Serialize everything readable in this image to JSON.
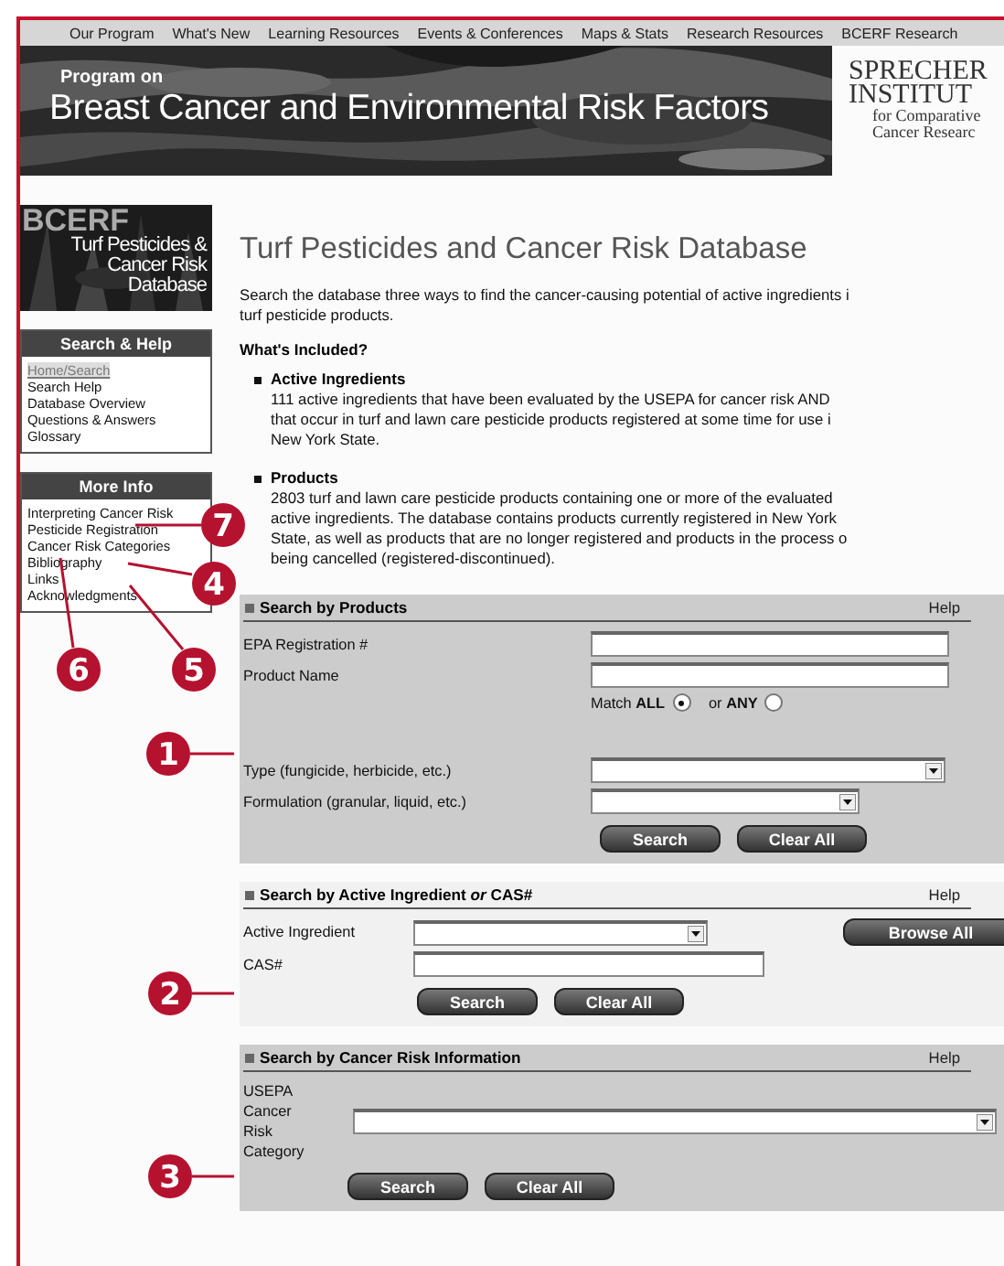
{
  "nav": [
    "Our Program",
    "What's New",
    "Learning Resources",
    "Events & Conferences",
    "Maps & Stats",
    "Research Resources",
    "BCERF Research"
  ],
  "banner": {
    "kicker": "Program on",
    "title": "Breast Cancer and Environmental Risk Factors"
  },
  "logo": {
    "lines": [
      "SPRECHER",
      "INSTITUT",
      "for Comparative",
      "Cancer Researc"
    ]
  },
  "sidebar": {
    "badge": {
      "lines": [
        "BCERF",
        "Turf Pesticides &",
        "Cancer Risk",
        "Database"
      ]
    },
    "boxes": [
      {
        "title": "Search & Help",
        "items": [
          {
            "label": "Home/Search",
            "selected": true
          },
          {
            "label": "Search Help",
            "selected": false
          },
          {
            "label": "Database Overview",
            "selected": false
          },
          {
            "label": "Questions & Answers",
            "selected": false
          },
          {
            "label": "Glossary",
            "selected": false
          }
        ]
      },
      {
        "title": "More Info",
        "items": [
          {
            "label": "Interpreting Cancer Risk",
            "selected": false
          },
          {
            "label": "Pesticide Registration",
            "selected": false
          },
          {
            "label": "Cancer Risk Categories",
            "selected": false
          },
          {
            "label": "Bibliography",
            "selected": false
          },
          {
            "label": "Links",
            "selected": false
          },
          {
            "label": "Acknowledgments",
            "selected": false
          }
        ]
      }
    ]
  },
  "main": {
    "title": "Turf Pesticides and Cancer Risk Database",
    "intro": [
      "Search the database three ways to find the cancer-causing potential of active ingredients i",
      "turf pesticide products."
    ],
    "included_heading": "What's Included?",
    "included": [
      {
        "title": "Active Ingredients",
        "lines": [
          "111 active ingredients that have been evaluated by the USEPA for cancer risk AND",
          "that occur in turf and lawn care pesticide products registered at some time for use i",
          "New York State."
        ]
      },
      {
        "title": "Products",
        "lines": [
          "2803 turf and lawn care pesticide products containing one or more of the evaluated",
          "active ingredients. The database contains products currently registered in New York",
          "State, as well as products that are no longer registered and products in the process o",
          "being cancelled (registered-discontinued)."
        ]
      }
    ]
  },
  "panels": [
    {
      "title": "Search by Products",
      "help": "Help",
      "fields": [
        {
          "kind": "input",
          "label": "EPA Registration #"
        },
        {
          "kind": "input",
          "label": "Product Name"
        },
        {
          "kind": "match",
          "options": [
            {
              "label": "Match **ALL**",
              "selected": true
            },
            {
              "label": "or **ANY**",
              "selected": false
            }
          ]
        },
        {
          "kind": "select",
          "label": "Type (fungicide, herbicide, etc.)"
        },
        {
          "kind": "select",
          "label": "Formulation (granular, liquid, etc.)"
        }
      ],
      "buttons": [
        "Search",
        "Clear All"
      ]
    },
    {
      "title": "Search by Active Ingredient *or* CAS#",
      "help": "Help",
      "fields": [
        {
          "kind": "select",
          "label": "Active Ingredient",
          "button": "Browse All"
        },
        {
          "kind": "input",
          "label": "CAS#"
        }
      ],
      "buttons": [
        "Search",
        "Clear All"
      ]
    },
    {
      "title": "Search by Cancer Risk Information",
      "help": "Help",
      "fields": [
        {
          "kind": "select",
          "label": "USEPA Cancer Risk Category"
        }
      ],
      "buttons": [
        "Search",
        "Clear All"
      ]
    }
  ],
  "callouts": [
    {
      "label": "7"
    },
    {
      "label": "4"
    },
    {
      "label": "6"
    },
    {
      "label": "5"
    },
    {
      "label": "1"
    },
    {
      "label": "2"
    },
    {
      "label": "3"
    }
  ]
}
